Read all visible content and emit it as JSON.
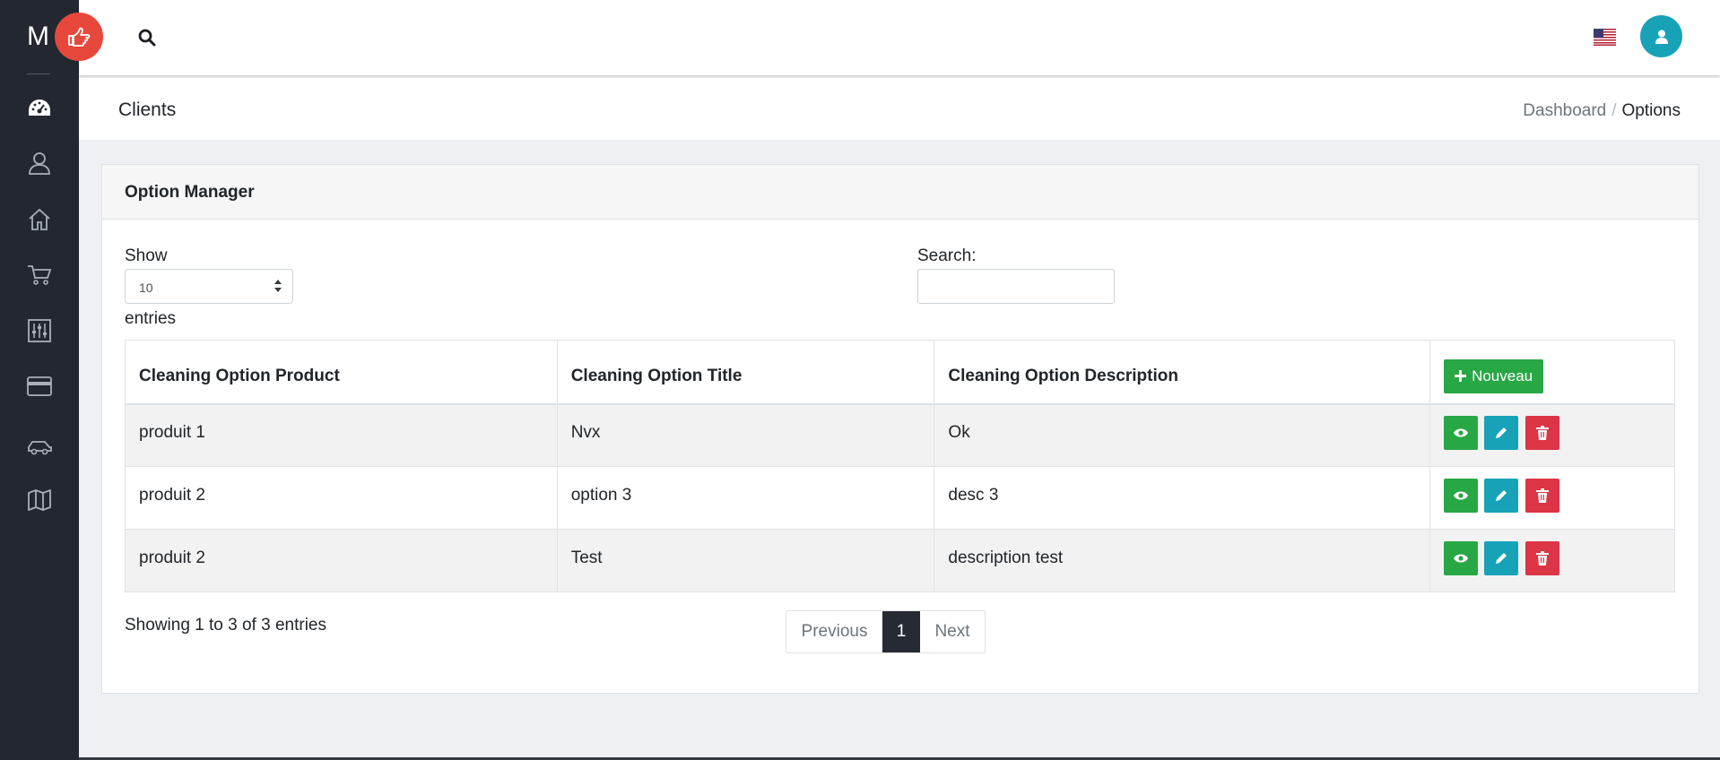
{
  "sidebar": {
    "logo_letter": "M",
    "icons": [
      "dashboard-icon",
      "user-icon",
      "home-icon",
      "cart-icon",
      "sliders-icon",
      "credit-card-icon",
      "car-icon",
      "map-icon"
    ]
  },
  "header": {
    "language_flag": "us-flag-icon",
    "avatar_color": "#17a2b8"
  },
  "titlebar": {
    "title": "Clients",
    "breadcrumb": [
      "Dashboard",
      "Options"
    ]
  },
  "card": {
    "title": "Option Manager",
    "show_label": "Show",
    "show_value": "10",
    "entries_label": "entries",
    "search_label": "Search:",
    "search_value": ""
  },
  "table": {
    "headers": [
      "Cleaning Option Product",
      "Cleaning Option Title",
      "Cleaning Option Description"
    ],
    "new_button": "Nouveau",
    "rows": [
      [
        "produit 1",
        "Nvx",
        "Ok"
      ],
      [
        "produit 2",
        "option 3",
        "desc 3"
      ],
      [
        "produit 2",
        "Test",
        "description test"
      ]
    ]
  },
  "footer": {
    "info": "Showing 1 to 3 of 3 entries",
    "prev": "Previous",
    "current_page": "1",
    "next": "Next"
  },
  "colors": {
    "sidebar": "#232830",
    "accent_red": "#e8483c",
    "success": "#28a745",
    "info": "#17a2b8",
    "danger": "#dc3545"
  }
}
